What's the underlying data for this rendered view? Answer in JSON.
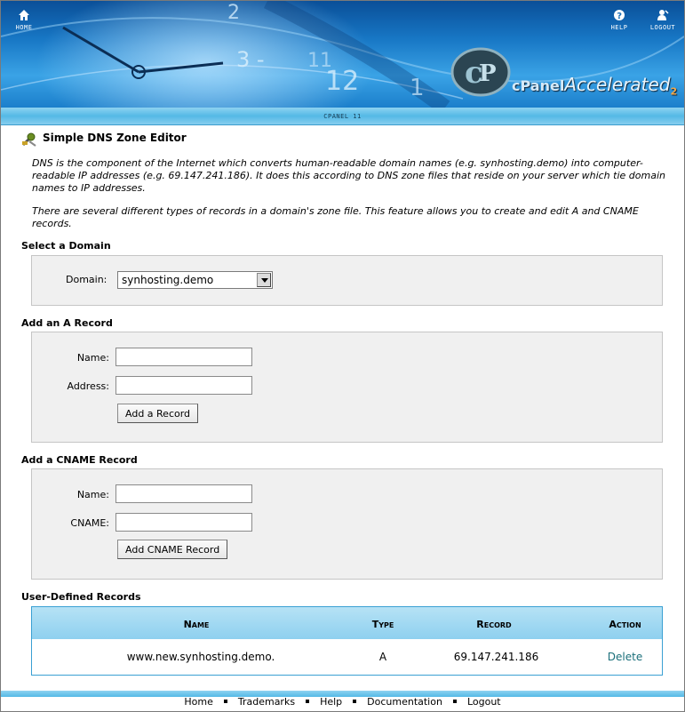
{
  "nav": {
    "home_label": "HOME",
    "help_label": "HELP",
    "logout_label": "LOGOUT"
  },
  "brand": {
    "cpanel": "cPanel",
    "accelerated": "Accelerated",
    "suffix": "2",
    "version": "CPANEL 11"
  },
  "page": {
    "title": "Simple DNS Zone Editor",
    "intro_1": "DNS is the component of the Internet which converts human-readable domain names (e.g. synhosting.demo) into computer-readable IP addresses (e.g. 69.147.241.186). It does this according to DNS zone files that reside on your server which tie domain names to IP addresses.",
    "intro_2": "There are several different types of records in a domain's zone file. This feature allows you to create and edit A and CNAME records."
  },
  "select_domain": {
    "heading": "Select a Domain",
    "label": "Domain:",
    "selected": "synhosting.demo"
  },
  "a_record": {
    "heading": "Add an A Record",
    "name_label": "Name:",
    "name_value": "",
    "address_label": "Address:",
    "address_value": "",
    "button": "Add a Record"
  },
  "cname_record": {
    "heading": "Add a CNAME Record",
    "name_label": "Name:",
    "name_value": "",
    "cname_label": "CNAME:",
    "cname_value": "",
    "button": "Add CNAME Record"
  },
  "records": {
    "heading": "User-Defined Records",
    "columns": [
      "Name",
      "Type",
      "Record",
      "Action"
    ],
    "rows": [
      {
        "name": "www.new.synhosting.demo.",
        "type": "A",
        "record": "69.147.241.186",
        "action": "Delete"
      }
    ]
  },
  "footer": {
    "links": [
      "Home",
      "Trademarks",
      "Help",
      "Documentation",
      "Logout"
    ]
  },
  "colors": {
    "banner_blue": "#1776c4",
    "strip_blue": "#54b9e6",
    "panel_gray": "#f0f0f0",
    "link_teal": "#1a6f7a"
  },
  "icons": {
    "home": "home-icon",
    "help": "help-icon",
    "logout": "logout-icon",
    "dns": "dns-tools-icon"
  }
}
